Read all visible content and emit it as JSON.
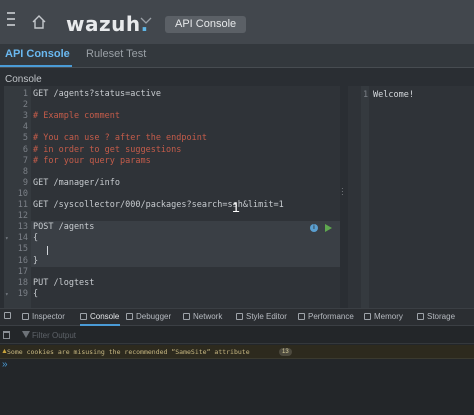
{
  "header": {
    "logo_text": "wazuh",
    "logo_dot": ".",
    "breadcrumb": "API Console"
  },
  "tabs": [
    {
      "label": "API Console",
      "active": true
    },
    {
      "label": "Ruleset Test",
      "active": false
    }
  ],
  "section_label": "Console",
  "editor": {
    "lines": [
      {
        "num": "1",
        "text": "GET /agents?status=active",
        "kind": "req"
      },
      {
        "num": "2",
        "text": "",
        "kind": "req"
      },
      {
        "num": "3",
        "text": "# Example comment",
        "kind": "comment"
      },
      {
        "num": "4",
        "text": "",
        "kind": "req"
      },
      {
        "num": "5",
        "text": "# You can use ? after the endpoint",
        "kind": "comment"
      },
      {
        "num": "6",
        "text": "# in order to get suggestions",
        "kind": "comment"
      },
      {
        "num": "7",
        "text": "# for your query params",
        "kind": "comment"
      },
      {
        "num": "8",
        "text": "",
        "kind": "req"
      },
      {
        "num": "9",
        "text": "GET /manager/info",
        "kind": "req"
      },
      {
        "num": "10",
        "text": "",
        "kind": "req"
      },
      {
        "num": "11",
        "text": "GET /syscollector/000/packages?search=ssh&limit=1",
        "kind": "req"
      },
      {
        "num": "12",
        "text": "",
        "kind": "req"
      },
      {
        "num": "13",
        "text": "POST /agents",
        "kind": "req"
      },
      {
        "num": "14",
        "text": "{",
        "kind": "req"
      },
      {
        "num": "15",
        "text": "",
        "kind": "req"
      },
      {
        "num": "16",
        "text": "}",
        "kind": "req"
      },
      {
        "num": "17",
        "text": "",
        "kind": "req"
      },
      {
        "num": "18",
        "text": "PUT /logtest",
        "kind": "req"
      },
      {
        "num": "19",
        "text": "{",
        "kind": "req"
      }
    ],
    "fold_markers": {
      "14": "▾",
      "19": "▾"
    }
  },
  "output": {
    "line_num": "1",
    "text": "Welcome!"
  },
  "overlay_number": "1",
  "devtools": {
    "tabs": [
      {
        "label": "Inspector",
        "icon": "inspector-icon"
      },
      {
        "label": "Console",
        "icon": "console-icon",
        "selected": true
      },
      {
        "label": "Debugger",
        "icon": "debugger-icon"
      },
      {
        "label": "Network",
        "icon": "network-icon"
      },
      {
        "label": "Style Editor",
        "icon": "style-editor-icon"
      },
      {
        "label": "Performance",
        "icon": "performance-icon"
      },
      {
        "label": "Memory",
        "icon": "memory-icon"
      },
      {
        "label": "Storage",
        "icon": "storage-icon"
      }
    ],
    "filter_placeholder": "Filter Output",
    "warning_text": "Some cookies are misusing the recommended “SameSite“ attribute",
    "warning_count": "13",
    "prompt": "»"
  },
  "colors": {
    "accent": "#4a9bd6",
    "comment": "#c45c4a",
    "play": "#5fa84f"
  }
}
